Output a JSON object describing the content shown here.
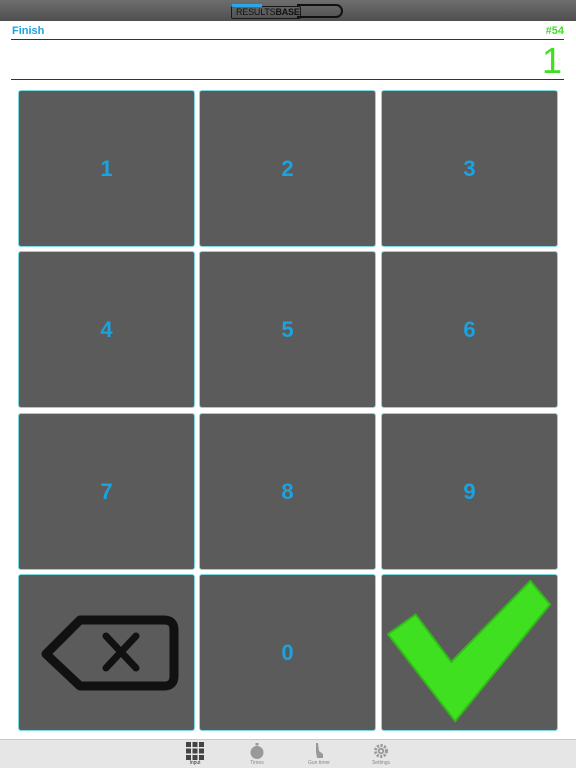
{
  "brand": {
    "logo_text_light": "RESULTS",
    "logo_text_bold": "BASE"
  },
  "header": {
    "mode_label": "Finish",
    "count_label": "#54"
  },
  "entry": {
    "value": "1"
  },
  "keypad": {
    "keys": [
      "1",
      "2",
      "3",
      "4",
      "5",
      "6",
      "7",
      "8",
      "9"
    ],
    "zero": "0",
    "delete_icon": "backspace-icon",
    "confirm_icon": "checkmark-icon"
  },
  "tabs": [
    {
      "label": "Input",
      "icon": "grid-icon",
      "active": true
    },
    {
      "label": "Times",
      "icon": "stopwatch-icon",
      "active": false
    },
    {
      "label": "Gun timer",
      "icon": "starter-pistol-icon",
      "active": false
    },
    {
      "label": "Settings",
      "icon": "gear-icon",
      "active": false
    }
  ],
  "colors": {
    "accent_blue": "#1aa3e0",
    "accent_green": "#3ee020",
    "key_bg": "#5b5b5b"
  }
}
